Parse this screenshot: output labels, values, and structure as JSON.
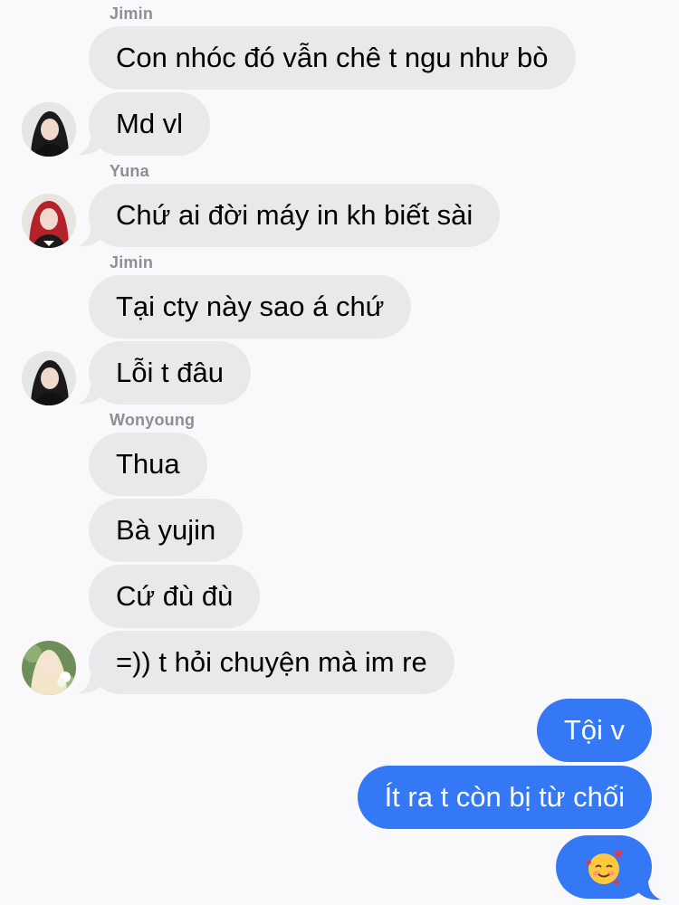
{
  "conversation": {
    "messages": [
      {
        "sender": "Jimin",
        "text": "Con nhóc đó vẫn chê t ngu như bò"
      },
      {
        "text": "Md vl"
      },
      {
        "sender": "Yuna",
        "text": "Chứ ai đời máy in kh biết sài"
      },
      {
        "sender": "Jimin",
        "text": "Tại cty này sao á chứ"
      },
      {
        "text": "Lỗi t đâu"
      },
      {
        "sender": "Wonyoung",
        "text": "Thua"
      },
      {
        "text": "Bà yujin"
      },
      {
        "text": "Cứ đù đù"
      },
      {
        "text": "=)) t hỏi chuyện mà im re"
      }
    ],
    "outgoing": [
      {
        "text": "Tội v"
      },
      {
        "text": "Ít ra t còn bị từ chối"
      },
      {
        "emoji": "smiling-face-with-hearts"
      }
    ]
  },
  "colors": {
    "incoming_bubble": "#e9e9eb",
    "outgoing_bubble": "#3478f6",
    "sender_name": "#8e8e93",
    "background": "#f9f9fb"
  }
}
